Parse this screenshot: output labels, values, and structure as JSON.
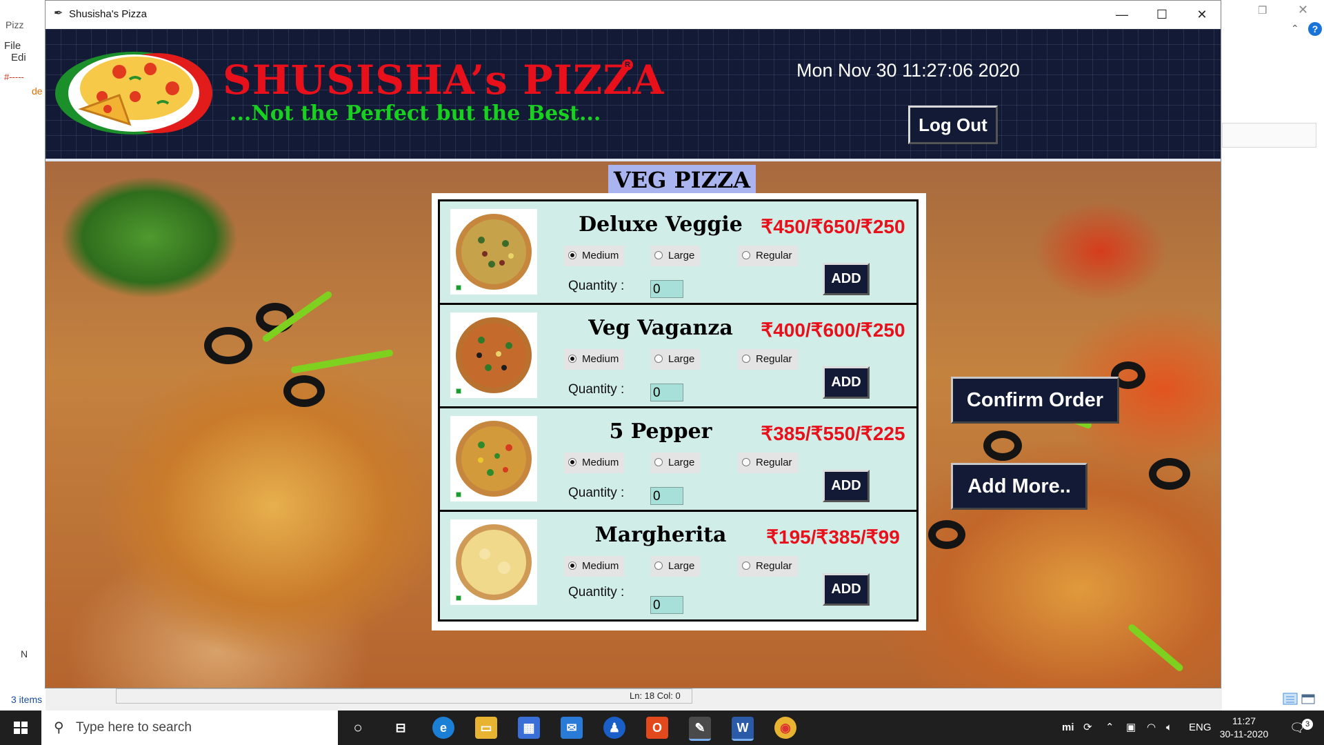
{
  "background": {
    "left_tab_label": "Pizz",
    "left_menu": [
      "File",
      "Edi"
    ],
    "left_code_line1": "#-----",
    "left_code_line2": "de",
    "left_bottom_item": "N",
    "items_count": "3 items",
    "status": "Ln: 18  Col: 0"
  },
  "window": {
    "title": "Shusisha's Pizza",
    "controls": {
      "minimize": "—",
      "maximize": "☐",
      "close": "✕"
    }
  },
  "header": {
    "brand": "SHUSISHA’s PIZZA",
    "registered_mark": "R",
    "tagline": "...Not the Perfect but the Best...",
    "datetime": "Mon Nov 30 11:27:06 2020",
    "logout_label": "Log Out"
  },
  "menu": {
    "section_title": "VEG PIZZA",
    "quantity_label": "Quantity :",
    "add_label": "ADD",
    "size_options": [
      "Medium",
      "Large",
      "Regular"
    ],
    "items": [
      {
        "name": "Deluxe Veggie",
        "price": "₹450/₹650/₹250",
        "selected_size": "Medium",
        "quantity": "0"
      },
      {
        "name": "Veg Vaganza",
        "price": "₹400/₹600/₹250",
        "selected_size": "Medium",
        "quantity": "0"
      },
      {
        "name": "5 Pepper",
        "price": "₹385/₹550/₹225",
        "selected_size": "Medium",
        "quantity": "0"
      },
      {
        "name": "Margherita",
        "price": "₹195/₹385/₹99",
        "selected_size": "Medium",
        "quantity": "0"
      }
    ]
  },
  "actions": {
    "confirm_label": "Confirm Order",
    "add_more_label": "Add More.."
  },
  "taskbar": {
    "search_placeholder": "Type here to search",
    "tray_lang": "ENG",
    "time": "11:27",
    "date": "30-11-2020",
    "notification_count": "3",
    "apps": [
      "task-view",
      "edge",
      "file-explorer",
      "store",
      "mail",
      "security",
      "office",
      "idle",
      "word",
      "chrome"
    ]
  },
  "colors": {
    "header_bg": "#131a35",
    "brand_red": "#e8101a",
    "tagline_green": "#18d01f",
    "card_bg": "#d1ede8",
    "section_title_bg": "#aab4ee",
    "button_bg": "#131a35"
  }
}
